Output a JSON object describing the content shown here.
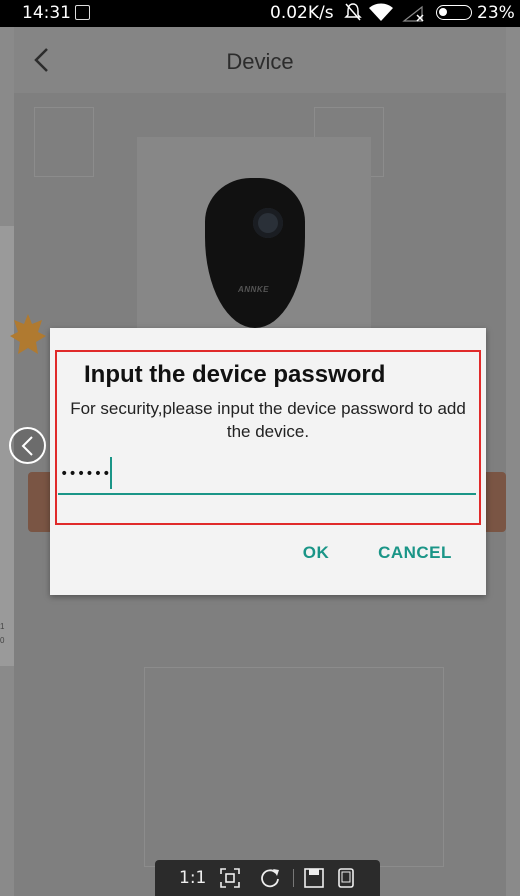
{
  "status_bar": {
    "time": "14:31",
    "network_speed": "0.02K/s",
    "battery_percent": "23%"
  },
  "header": {
    "title": "Device"
  },
  "camera": {
    "brand": "ANNKE"
  },
  "dialog": {
    "title": "Input the device password",
    "message": "For security,please input the device password to add the device.",
    "password_value": "••••••",
    "ok_label": "OK",
    "cancel_label": "CANCEL",
    "accent_color": "#1a9587",
    "highlight_color": "#e02a2a"
  },
  "viewer_toolbar": {
    "zoom_label": "1:1"
  },
  "left_strip": {
    "chars": [
      "1",
      "0"
    ]
  }
}
